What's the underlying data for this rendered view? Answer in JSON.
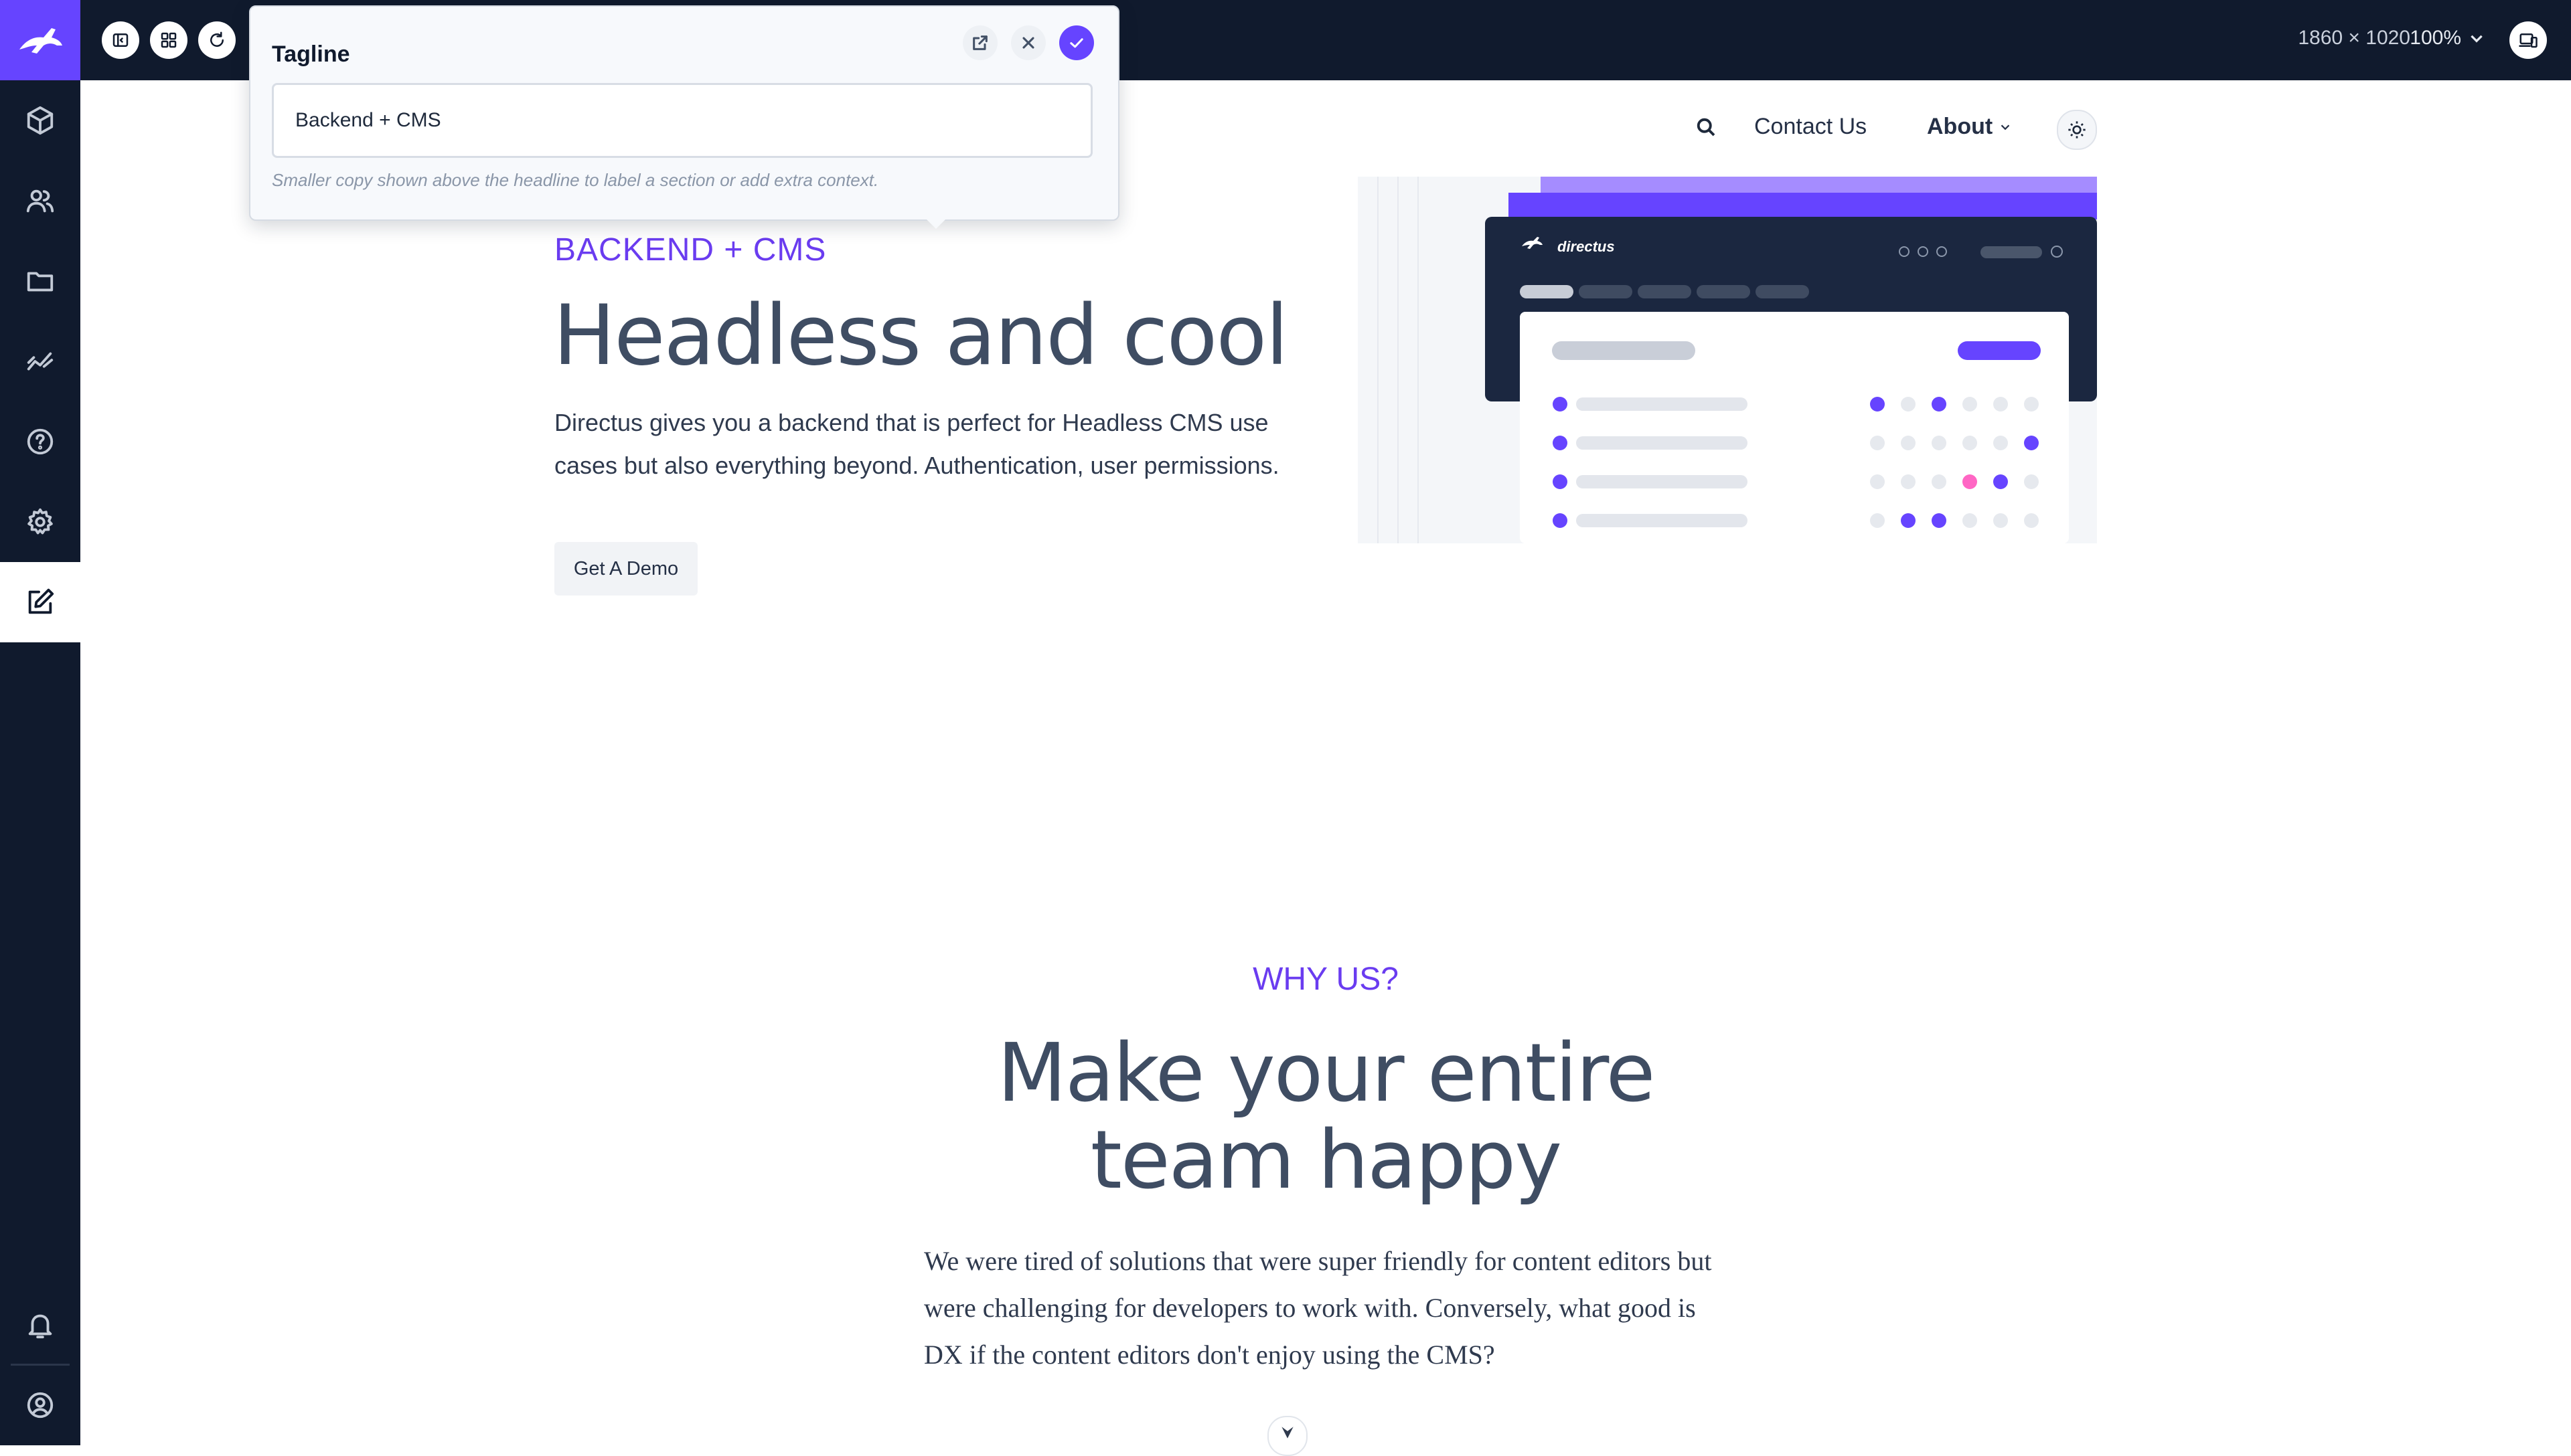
{
  "toolbar": {
    "viewport_size": "1860 × 1020",
    "zoom": "100%"
  },
  "popover": {
    "title": "Tagline",
    "value": "Backend + CMS",
    "hint": "Smaller copy shown above the headline to label a section or add extra context."
  },
  "nav": {
    "contact": "Contact Us",
    "about": "About"
  },
  "hero": {
    "tagline": "BACKEND + CMS",
    "title": "Headless and cool",
    "text": "Directus gives you a backend that is perfect for Headless CMS use cases but also everything beyond. Authentication, user permissions.",
    "cta": "Get A Demo"
  },
  "illustration": {
    "brand": "directus"
  },
  "why": {
    "tagline": "WHY US?",
    "title_line1": "Make your entire",
    "title_line2": "team happy",
    "text": "We were tired of solutions that were super friendly for content editors but were challenging for developers to work with. Conversely, what good is DX if the content editors don't enjoy using the CMS?"
  },
  "colors": {
    "accent": "#6644ff",
    "rail": "#101a2d",
    "pink": "#ff66c4"
  }
}
